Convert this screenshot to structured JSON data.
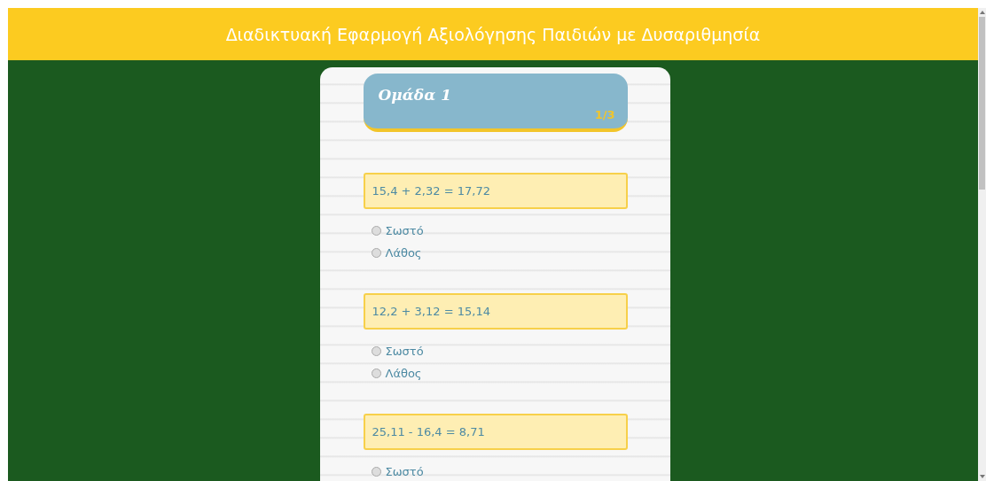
{
  "header": {
    "title": "Διαδικτυακή Εφαρμογή Αξιολόγησης Παιδιών με Δυσαριθμησία"
  },
  "group": {
    "title": "Ομάδα 1",
    "progress": "1/3"
  },
  "questions": [
    {
      "text": "15,4 + 2,32 = 17,72",
      "options": [
        {
          "label": "Σωστό",
          "selected": false
        },
        {
          "label": "Λάθος",
          "selected": false
        }
      ]
    },
    {
      "text": "12,2 + 3,12 = 15,14",
      "options": [
        {
          "label": "Σωστό",
          "selected": false
        },
        {
          "label": "Λάθος",
          "selected": false
        }
      ]
    },
    {
      "text": "25,11 - 16,4 = 8,71",
      "options": [
        {
          "label": "Σωστό",
          "selected": false
        }
      ]
    }
  ]
}
